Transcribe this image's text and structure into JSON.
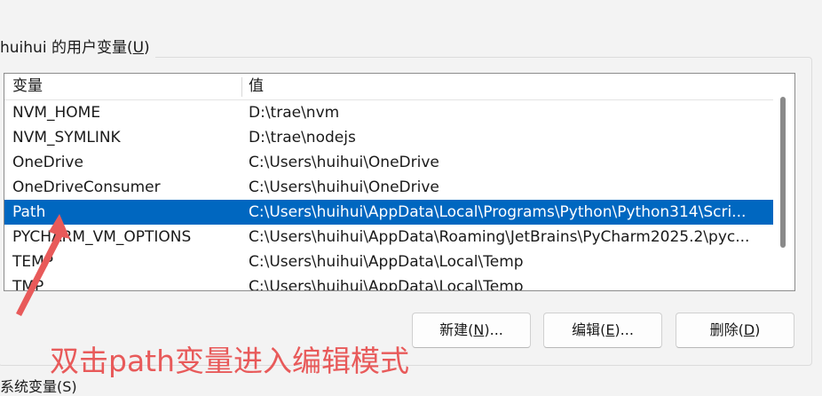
{
  "group": {
    "title_prefix": "huihui 的用户变量(",
    "title_mnemonic": "U",
    "title_suffix": ")"
  },
  "table": {
    "columns": [
      "变量",
      "值"
    ],
    "selected_index": 4,
    "rows": [
      {
        "name": "NVM_HOME",
        "value": "D:\\trae\\nvm"
      },
      {
        "name": "NVM_SYMLINK",
        "value": "D:\\trae\\nodejs"
      },
      {
        "name": "OneDrive",
        "value": "C:\\Users\\huihui\\OneDrive"
      },
      {
        "name": "OneDriveConsumer",
        "value": "C:\\Users\\huihui\\OneDrive"
      },
      {
        "name": "Path",
        "value": "C:\\Users\\huihui\\AppData\\Local\\Programs\\Python\\Python314\\Scri..."
      },
      {
        "name": "PYCHARM_VM_OPTIONS",
        "value": "C:\\Users\\huihui\\AppData\\Roaming\\JetBrains\\PyCharm2025.2\\pyc..."
      },
      {
        "name": "TEMP",
        "value": "C:\\Users\\huihui\\AppData\\Local\\Temp"
      },
      {
        "name": "TMP",
        "value": "C:\\Users\\huihui\\AppData\\Local\\Temp"
      }
    ]
  },
  "buttons": {
    "new": {
      "prefix": "新建(",
      "mnemonic": "N",
      "suffix": ")..."
    },
    "edit": {
      "prefix": "编辑(",
      "mnemonic": "E",
      "suffix": ")..."
    },
    "delete": {
      "prefix": "删除(",
      "mnemonic": "D",
      "suffix": ")"
    }
  },
  "annotation": {
    "text": "双击path变量进入编辑模式",
    "color": "#e85a5a"
  },
  "bottom_group_partial": "系统变量(S)",
  "colors": {
    "selection": "#0067c0",
    "background": "#f3f3f3"
  }
}
